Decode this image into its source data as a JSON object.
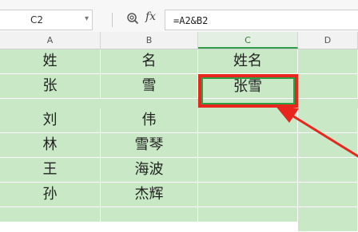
{
  "formula_bar": {
    "name_box": "C2",
    "fx_label": "fx",
    "formula": "=A2&B2"
  },
  "columns": [
    {
      "label": "A"
    },
    {
      "label": "B"
    },
    {
      "label": "C"
    },
    {
      "label": "D"
    }
  ],
  "rows": [
    {
      "a": "姓",
      "b": "名",
      "c": "姓名"
    },
    {
      "a": "张",
      "b": "雪",
      "c": "张雪"
    },
    {
      "a": "刘",
      "b": "伟",
      "c": ""
    },
    {
      "a": "林",
      "b": "雪琴",
      "c": ""
    },
    {
      "a": "王",
      "b": "海波",
      "c": ""
    },
    {
      "a": "孙",
      "b": "杰辉",
      "c": ""
    },
    {
      "a": "",
      "b": "",
      "c": ""
    }
  ],
  "colors": {
    "cell_fill": "#c9e9c6",
    "highlight_box": "#e8261e",
    "selection": "#2e9d45"
  }
}
